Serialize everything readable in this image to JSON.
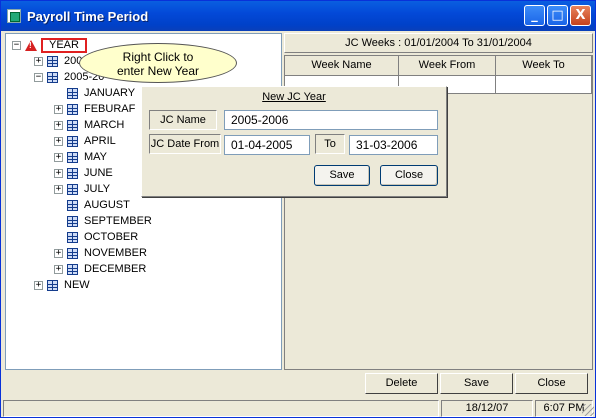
{
  "window": {
    "title": "Payroll Time Period",
    "controls": {
      "minimize": "_",
      "maximize": "□",
      "close": "X"
    }
  },
  "tree": {
    "root": "YEAR",
    "nodes": [
      {
        "label": "200",
        "expander": "+"
      },
      {
        "label": "2005-20",
        "expander": "−"
      },
      {
        "label": "JANUARY",
        "expander": ""
      },
      {
        "label": "FEBURAF",
        "expander": "+"
      },
      {
        "label": "MARCH",
        "expander": "+"
      },
      {
        "label": "APRIL",
        "expander": "+"
      },
      {
        "label": "MAY",
        "expander": "+"
      },
      {
        "label": "JUNE",
        "expander": "+"
      },
      {
        "label": "JULY",
        "expander": "+"
      },
      {
        "label": "AUGUST",
        "expander": ""
      },
      {
        "label": "SEPTEMBER",
        "expander": ""
      },
      {
        "label": "OCTOBER",
        "expander": ""
      },
      {
        "label": "NOVEMBER",
        "expander": "+"
      },
      {
        "label": "DECEMBER",
        "expander": "+"
      },
      {
        "label": "NEW",
        "expander": "+"
      }
    ]
  },
  "callout": {
    "line1": "Right Click to",
    "line2": "enter New Year"
  },
  "weeks": {
    "header": "JC Weeks : 01/01/2004 To 31/01/2004",
    "columns": [
      "Week Name",
      "Week From",
      "Week To"
    ]
  },
  "dialog": {
    "title": "New JC Year",
    "name_label": "JC Name",
    "name_value": "2005-2006",
    "from_label": "JC Date From",
    "from_value": "01-04-2005",
    "to_label": "To",
    "to_value": "31-03-2006",
    "save": "Save",
    "close": "Close"
  },
  "buttons": {
    "delete": "Delete",
    "save": "Save",
    "close": "Close"
  },
  "status": {
    "date": "18/12/07",
    "time": "6:07 PM"
  }
}
